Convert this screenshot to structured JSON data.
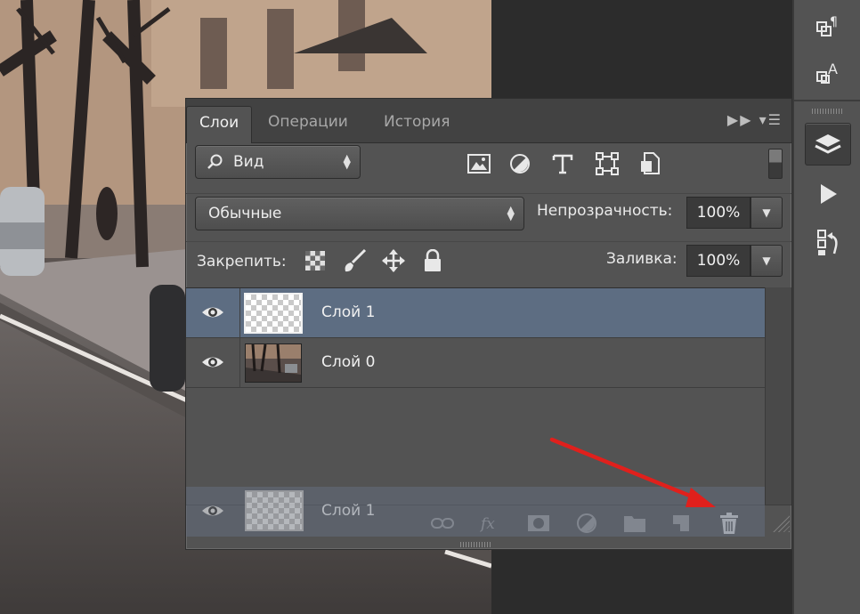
{
  "panel": {
    "tabs": [
      {
        "label": "Слои",
        "active": true
      },
      {
        "label": "Операции",
        "active": false
      },
      {
        "label": "История",
        "active": false
      }
    ],
    "filter_kind": "Вид",
    "filter_icons": [
      "image-filter-icon",
      "adjustment-filter-icon",
      "type-filter-icon",
      "shape-filter-icon",
      "smart-object-filter-icon"
    ],
    "blend_mode": "Обычные",
    "opacity_label": "Непрозрачность:",
    "opacity_value": "100%",
    "lock_label": "Закрепить:",
    "lock_icons": [
      "lock-transparent-icon",
      "lock-image-icon",
      "lock-position-icon",
      "lock-all-icon"
    ],
    "fill_label": "Заливка:",
    "fill_value": "100%"
  },
  "layers": [
    {
      "name": "Слой 1",
      "selected": true,
      "thumbnail": "transparent"
    },
    {
      "name": "Слой 0",
      "selected": false,
      "thumbnail": "photo"
    }
  ],
  "dragged_layer": {
    "name": "Слой 1"
  },
  "footer_icons": [
    "link-layers-icon",
    "fx-icon",
    "add-mask-icon",
    "adjustment-layer-icon",
    "new-group-icon",
    "new-layer-icon",
    "trash-icon"
  ],
  "dock_icons": [
    "paragraph-panel-icon",
    "character-panel-icon",
    "layers-panel-icon",
    "actions-panel-icon",
    "history-panel-icon"
  ],
  "colors": {
    "panel_bg": "#535353",
    "selected_row": "#5d6d82",
    "annotation_arrow": "#e0201c"
  }
}
